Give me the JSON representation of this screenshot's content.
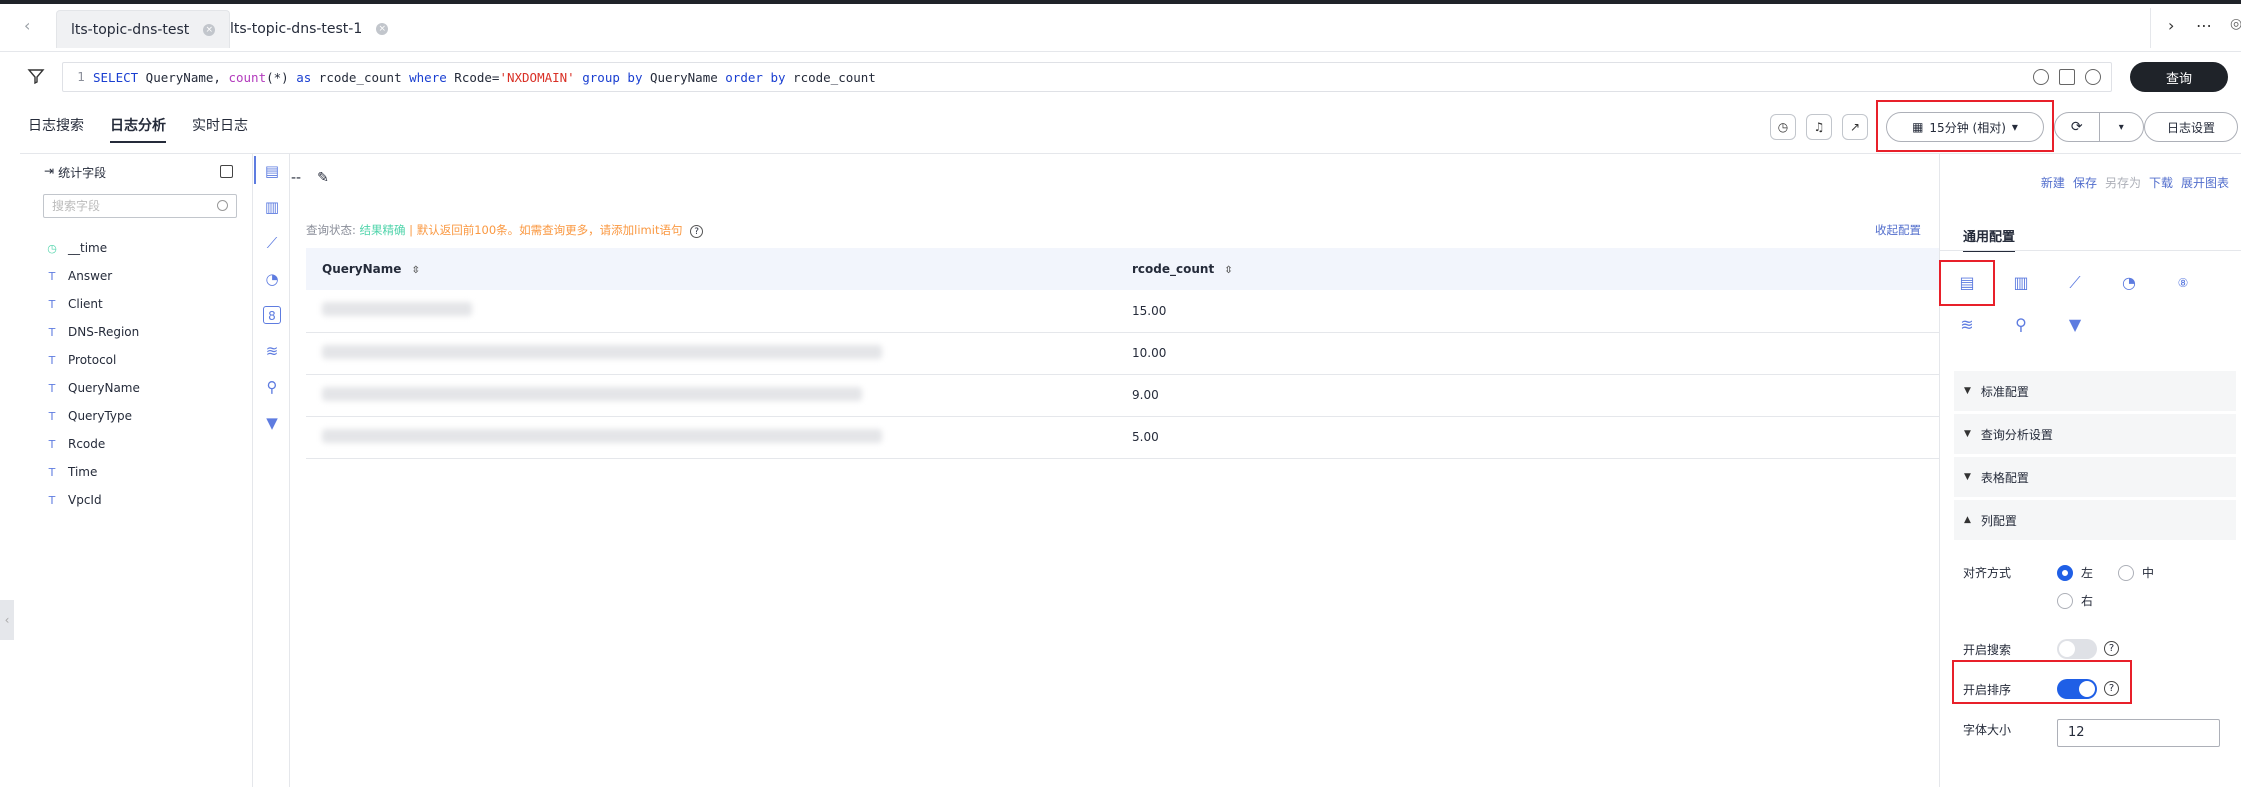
{
  "tabs": [
    {
      "label": "lts-topic-dns-test",
      "active": true
    },
    {
      "label": "lts-topic-dns-test-1",
      "active": false
    }
  ],
  "query": {
    "line_no": "1",
    "sql_tokens": [
      {
        "t": "SELECT",
        "c": "kw"
      },
      {
        "t": " QueryName, ",
        "c": "id"
      },
      {
        "t": "count",
        "c": "fn"
      },
      {
        "t": "(*) ",
        "c": "id"
      },
      {
        "t": "as",
        "c": "kw"
      },
      {
        "t": " rcode_count ",
        "c": "id"
      },
      {
        "t": "where",
        "c": "kw"
      },
      {
        "t": " Rcode=",
        "c": "id"
      },
      {
        "t": "'NXDOMAIN'",
        "c": "str"
      },
      {
        "t": " ",
        "c": "id"
      },
      {
        "t": "group",
        "c": "kw"
      },
      {
        "t": " ",
        "c": "id"
      },
      {
        "t": "by",
        "c": "kw"
      },
      {
        "t": " QueryName ",
        "c": "id"
      },
      {
        "t": "order",
        "c": "kw"
      },
      {
        "t": " ",
        "c": "id"
      },
      {
        "t": "by",
        "c": "kw"
      },
      {
        "t": " rcode_count",
        "c": "id"
      }
    ],
    "query_button": "查询"
  },
  "subtabs": [
    {
      "label": "日志搜索",
      "active": false
    },
    {
      "label": "日志分析",
      "active": true
    },
    {
      "label": "实时日志",
      "active": false
    }
  ],
  "time_range": "15分钟 (相对)",
  "log_settings": "日志设置",
  "left_panel": {
    "title": "统计字段",
    "search_placeholder": "搜索字段",
    "fields": [
      {
        "name": "__time",
        "type": "time"
      },
      {
        "name": "Answer",
        "type": "T"
      },
      {
        "name": "Client",
        "type": "T"
      },
      {
        "name": "DNS-Region",
        "type": "T"
      },
      {
        "name": "Protocol",
        "type": "T"
      },
      {
        "name": "QueryName",
        "type": "T"
      },
      {
        "name": "QueryType",
        "type": "T"
      },
      {
        "name": "Rcode",
        "type": "T"
      },
      {
        "name": "Time",
        "type": "T"
      },
      {
        "name": "VpcId",
        "type": "T"
      }
    ]
  },
  "main": {
    "chart_name": "--",
    "status_label": "查询状态:",
    "status_ok": "结果精确",
    "status_warn": " | 默认返回前100条。如需查询更多，请添加limit语句",
    "collapse_config": "收起配置",
    "columns": [
      "QueryName",
      "rcode_count"
    ],
    "rows": [
      {
        "rcode_count": "15.00"
      },
      {
        "rcode_count": "10.00"
      },
      {
        "rcode_count": "9.00"
      },
      {
        "rcode_count": "5.00"
      }
    ]
  },
  "right_panel": {
    "links": [
      {
        "label": "新建",
        "disabled": false
      },
      {
        "label": "保存",
        "disabled": false
      },
      {
        "label": "另存为",
        "disabled": true
      },
      {
        "label": "下载",
        "disabled": false
      },
      {
        "label": "展开图表",
        "disabled": false
      }
    ],
    "tab": "通用配置",
    "sections": [
      "标准配置",
      "查询分析设置",
      "表格配置",
      "列配置"
    ],
    "align_label": "对齐方式",
    "align_options": [
      "左",
      "中",
      "右"
    ],
    "align_selected": "左",
    "search_label": "开启搜索",
    "search_enabled": false,
    "sort_label": "开启排序",
    "sort_enabled": true,
    "font_size_label": "字体大小",
    "font_size_value": "12"
  }
}
